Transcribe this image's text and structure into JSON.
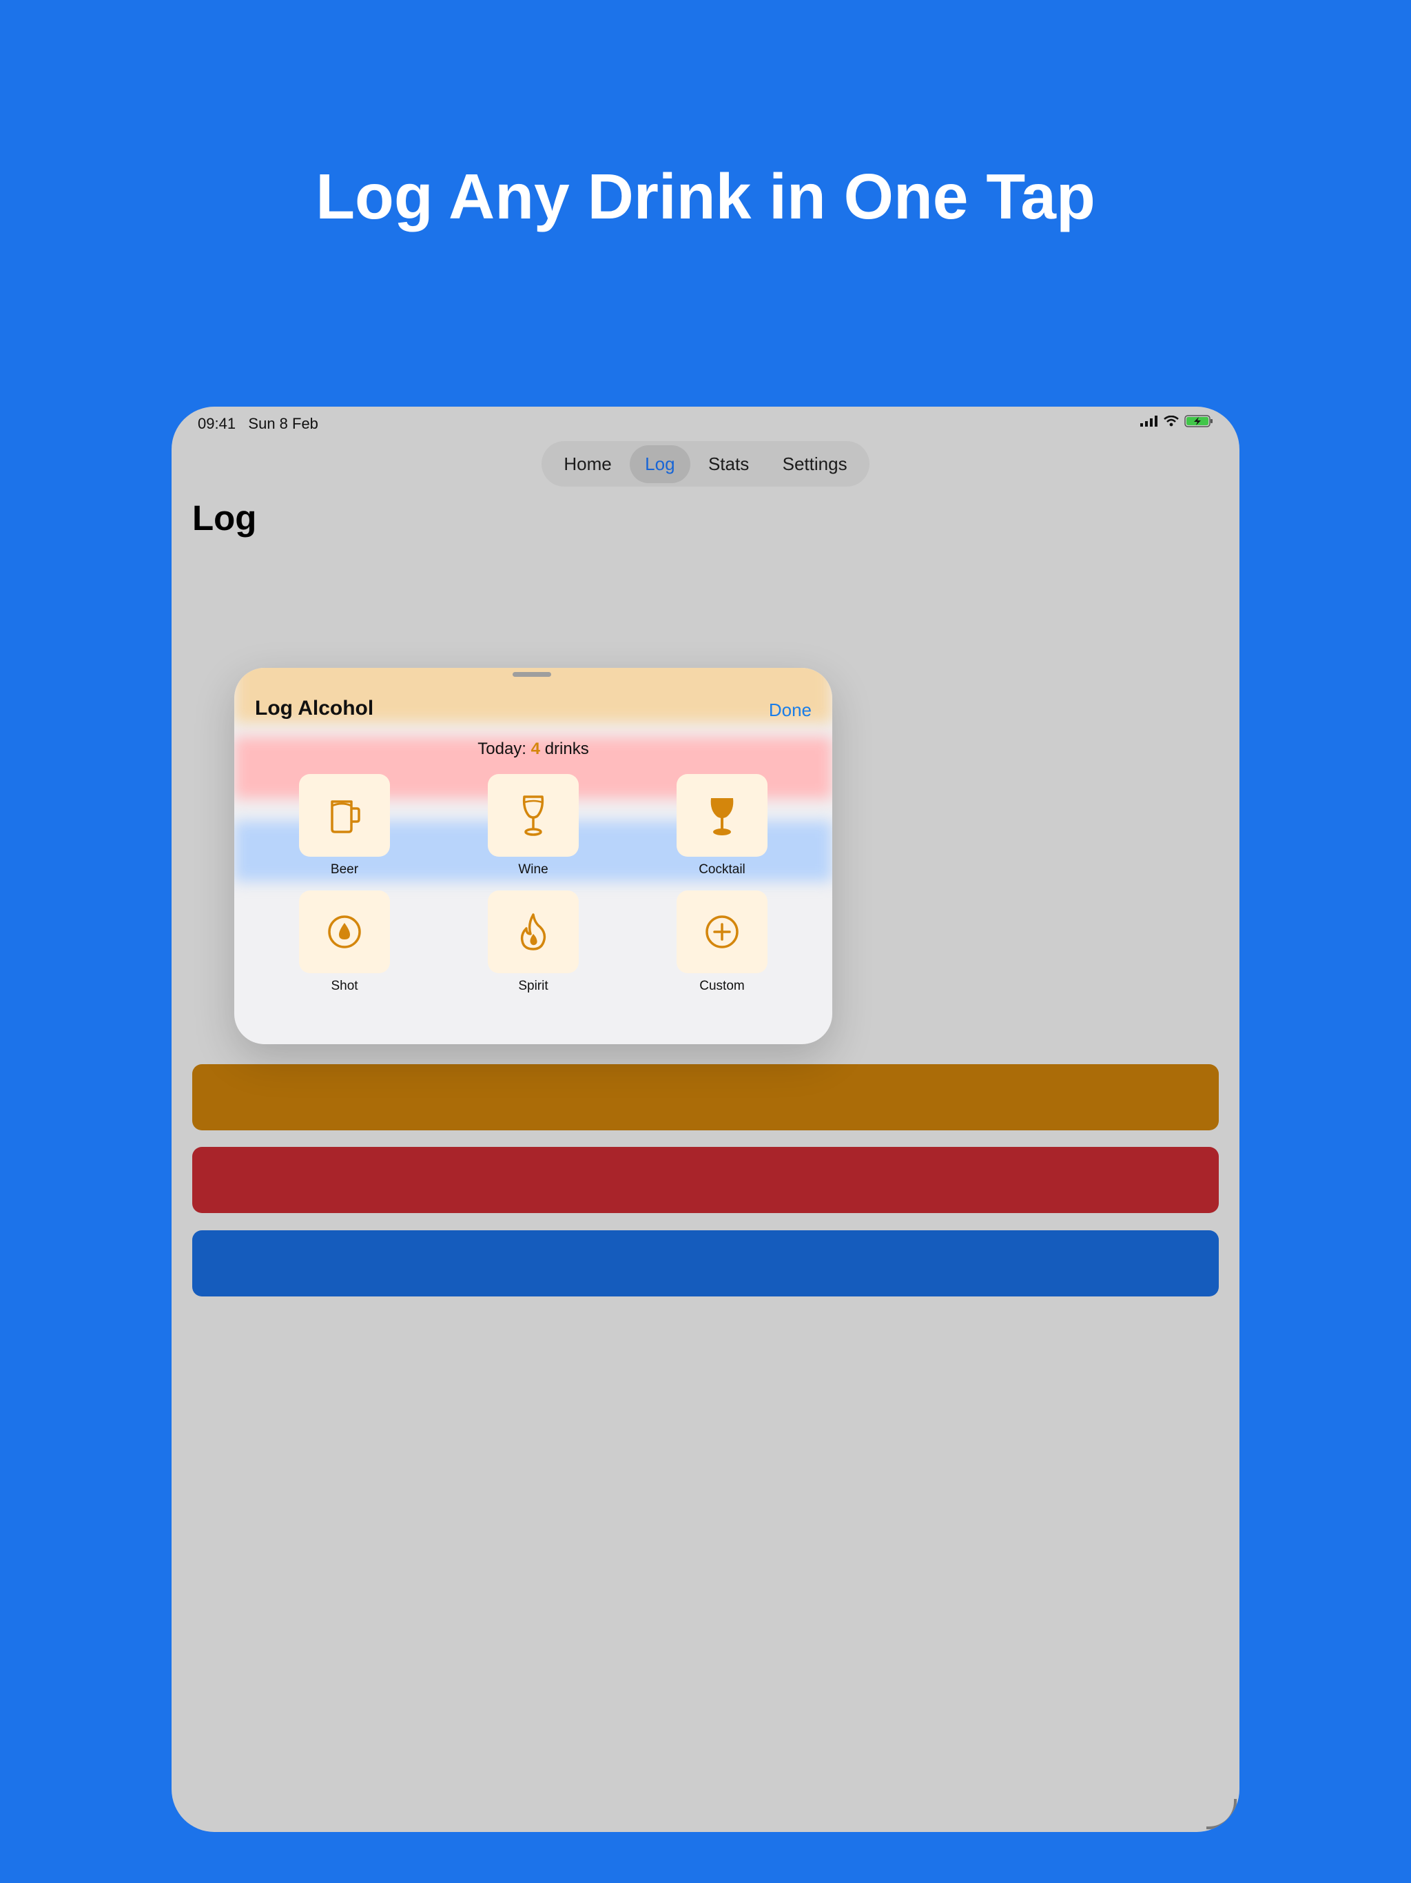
{
  "headline": "Log Any Drink in One Tap",
  "status_bar": {
    "time": "09:41",
    "date": "Sun 8 Feb"
  },
  "tabs": [
    {
      "label": "Home",
      "active": false
    },
    {
      "label": "Log",
      "active": true
    },
    {
      "label": "Stats",
      "active": false
    },
    {
      "label": "Settings",
      "active": false
    }
  ],
  "page": {
    "title": "Log"
  },
  "sheet": {
    "title": "Log Alcohol",
    "done_label": "Done",
    "today_prefix": "Today:",
    "today_count": "4",
    "today_suffix": "drinks",
    "drinks": [
      {
        "label": "Beer",
        "icon": "mug-icon"
      },
      {
        "label": "Wine",
        "icon": "wine-glass-icon"
      },
      {
        "label": "Cocktail",
        "icon": "cocktail-glass-icon"
      },
      {
        "label": "Shot",
        "icon": "drop-icon"
      },
      {
        "label": "Spirit",
        "icon": "flame-icon"
      },
      {
        "label": "Custom",
        "icon": "plus-circle-icon"
      }
    ]
  },
  "colors": {
    "background": "#1c73ea",
    "accent": "#d4860c",
    "tint": "#1a7de8",
    "button_orange": "#ab6c08",
    "button_red": "#a9242a",
    "button_blue": "#155cbd"
  }
}
